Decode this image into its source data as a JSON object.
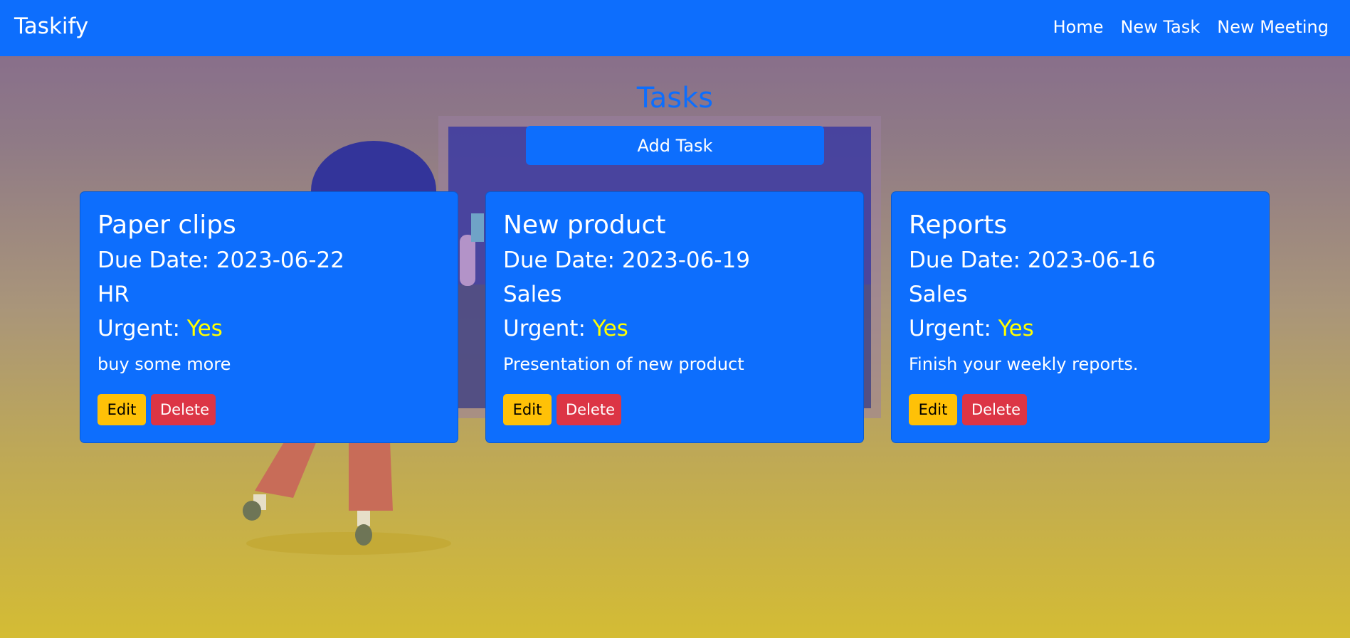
{
  "navbar": {
    "brand": "Taskify",
    "links": [
      "Home",
      "New Task",
      "New Meeting"
    ]
  },
  "main": {
    "title": "Tasks",
    "add_button_label": "Add Task"
  },
  "tasks": [
    {
      "title": "Paper clips",
      "due_label": "Due Date: 2023-06-22",
      "department": "HR",
      "urgent_label": "Urgent:",
      "urgent_value": "Yes",
      "description": "buy some more",
      "edit_label": "Edit",
      "delete_label": "Delete"
    },
    {
      "title": "New product",
      "due_label": "Due Date: 2023-06-19",
      "department": "Sales",
      "urgent_label": "Urgent:",
      "urgent_value": "Yes",
      "description": "Presentation of new product",
      "edit_label": "Edit",
      "delete_label": "Delete"
    },
    {
      "title": "Reports",
      "due_label": "Due Date: 2023-06-16",
      "department": "Sales",
      "urgent_label": "Urgent:",
      "urgent_value": "Yes",
      "description": "Finish your weekly reports.",
      "edit_label": "Edit",
      "delete_label": "Delete"
    }
  ],
  "colors": {
    "primary": "#0d6efd",
    "warning": "#ffc107",
    "danger": "#dc3545",
    "urgent_text": "#ffff00",
    "background_top": "#84688e",
    "background_bottom": "#d4bc34"
  }
}
